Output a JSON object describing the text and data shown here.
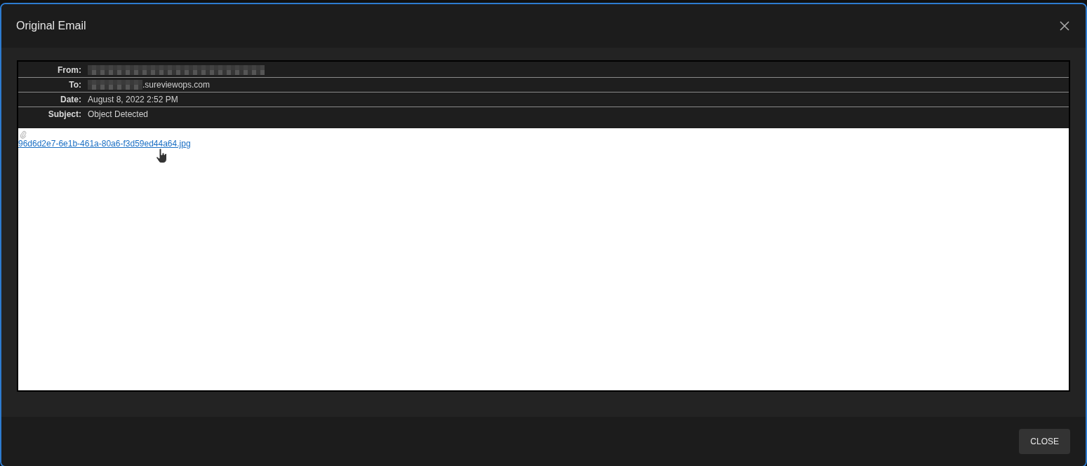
{
  "dialog": {
    "title": "Original Email"
  },
  "headers": [
    {
      "label": "From:",
      "kind": "redacted"
    },
    {
      "label": "To:",
      "kind": "partly_redacted",
      "value": ".sureviewops.com"
    },
    {
      "label": "Date:",
      "kind": "plain",
      "value": "August 8, 2022 2:52 PM"
    },
    {
      "label": "Subject:",
      "kind": "plain",
      "value": "Object Detected"
    }
  ],
  "attachment": {
    "name": "96d6d2e7-6e1b-461a-80a6-f3d59ed44a64.jpg"
  },
  "buttons": [
    {
      "label": "CLOSE"
    }
  ]
}
